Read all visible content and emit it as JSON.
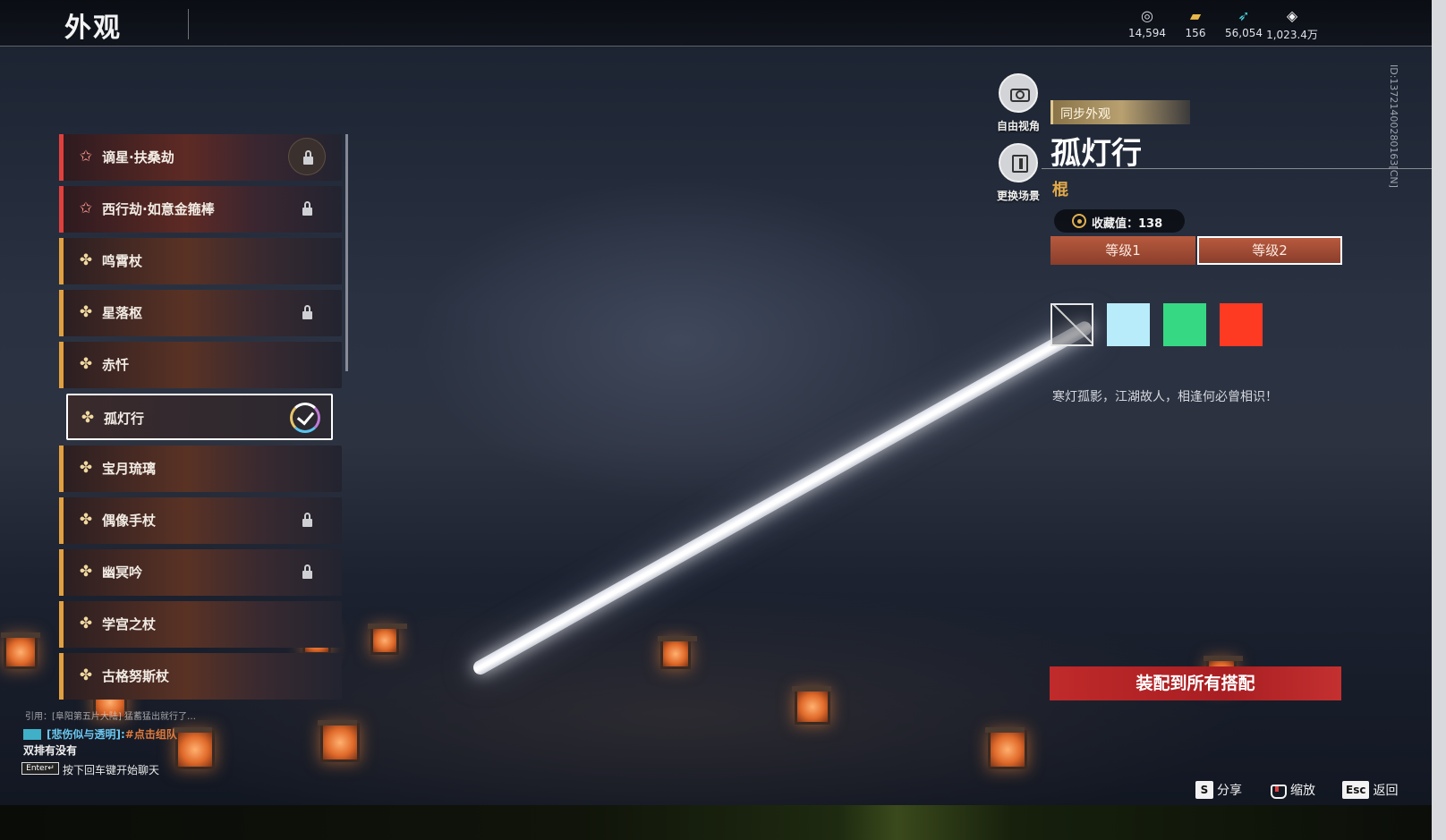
{
  "header": {
    "title": "外观",
    "currencies": [
      {
        "icon": "jade-coin-icon",
        "value": "14,594"
      },
      {
        "icon": "gold-ingot-icon",
        "value": "156"
      },
      {
        "icon": "feather-icon",
        "value": "56,054"
      },
      {
        "icon": "diamond-token-icon",
        "value": "1,023.4万"
      }
    ]
  },
  "items": [
    {
      "name": "谪星·扶桑劫",
      "rarity": "red",
      "locked": true
    },
    {
      "name": "西行劫·如意金箍棒",
      "rarity": "red",
      "locked": true
    },
    {
      "name": "鸣霄杖",
      "rarity": "gold",
      "locked": false
    },
    {
      "name": "星落枢",
      "rarity": "gold",
      "locked": true
    },
    {
      "name": "赤忏",
      "rarity": "gold",
      "locked": false
    },
    {
      "name": "孤灯行",
      "rarity": "gold",
      "locked": false,
      "selected": true
    },
    {
      "name": "宝月琉璃",
      "rarity": "gold",
      "locked": false
    },
    {
      "name": "偶像手杖",
      "rarity": "gold",
      "locked": true
    },
    {
      "name": "幽冥吟",
      "rarity": "gold",
      "locked": true
    },
    {
      "name": "学宫之杖",
      "rarity": "gold",
      "locked": false
    },
    {
      "name": "古格努斯杖",
      "rarity": "gold",
      "locked": false
    }
  ],
  "view_controls": {
    "free_view": "自由视角",
    "change_scene": "更换场景"
  },
  "detail": {
    "sync_badge": "同步外观",
    "title": "孤灯行",
    "weapon_type": "棍",
    "collection": "收藏值：138",
    "levels": [
      "等级1",
      "等级2"
    ],
    "active_level": "等级2",
    "swatches": [
      {
        "kind": "none",
        "color": ""
      },
      {
        "kind": "color",
        "color": "#b8ecfa"
      },
      {
        "kind": "color",
        "color": "#36d884"
      },
      {
        "kind": "color",
        "color": "#ff3a22"
      }
    ],
    "flavor": "寒灯孤影，江湖故人，相逢何必曾相识！",
    "equip_all": "装配到所有搭配"
  },
  "side_id": "ID:137214002801​63[CN]",
  "chat": {
    "quote": "引用：[阜阳第五片大陆] 猛蓄猛出就行了…",
    "user": "[悲伤似与透明]:",
    "link": "#点击组队",
    "message": "双排有没有",
    "enter_key": "Enter↵",
    "hint": "按下回车键开始聊天"
  },
  "hints": [
    {
      "key": "S",
      "label": "分享"
    },
    {
      "key": "zoom",
      "label": "缩放"
    },
    {
      "key": "Esc",
      "label": "返回"
    }
  ],
  "colors": {
    "accent_red": "#c02a2a",
    "accent_gold": "#e0a040",
    "level_tab": "#b85a3e"
  }
}
